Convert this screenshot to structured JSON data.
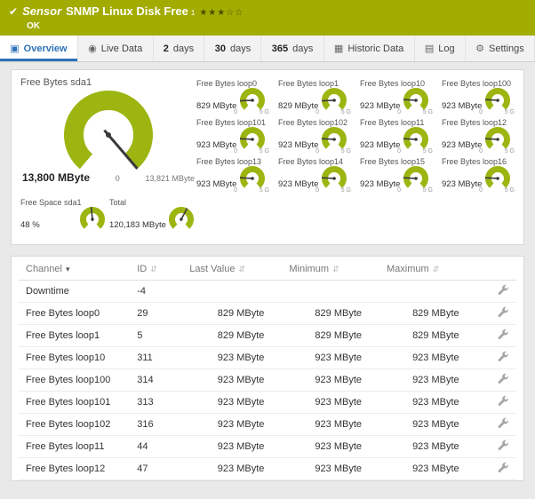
{
  "colors": {
    "header_green": "#a2ab00",
    "gauge_green": "#9db511",
    "active_tab_blue": "#2e71b8"
  },
  "icons": {
    "header_status": "check-icon",
    "tab_overview": "grid-icon",
    "tab_live": "broadcast-icon",
    "tab_historic": "chart-icon",
    "tab_log": "list-icon",
    "tab_settings": "gear-icon",
    "row_action": "wrench-icon",
    "sort_channel": "caret-down-icon",
    "sort_other": "updown-arrows-icon"
  },
  "header": {
    "kind": "Sensor",
    "title": "SNMP Linux Disk Free",
    "superscript": "1",
    "priority_stars": "★★★☆☆",
    "status": "OK"
  },
  "tabs": [
    {
      "label": "Overview"
    },
    {
      "label": "Live Data"
    },
    {
      "num": "2",
      "label": "days"
    },
    {
      "num": "30",
      "label": "days"
    },
    {
      "num": "365",
      "label": "days"
    },
    {
      "label": "Historic Data"
    },
    {
      "label": "Log"
    },
    {
      "label": "Settings"
    }
  ],
  "gauges": {
    "main": {
      "label": "Free Bytes sda1",
      "value": "13,800 MByte",
      "tick_min": "0",
      "tick_max": "13,821 MByte",
      "fraction": 0.998
    },
    "small": [
      {
        "label": "Free Bytes loop0",
        "value": "829 MByte",
        "tick_min": "0",
        "tick_max": "5 G",
        "fraction": 0.17
      },
      {
        "label": "Free Bytes loop1",
        "value": "829 MByte",
        "tick_min": "0",
        "tick_max": "5 G",
        "fraction": 0.17
      },
      {
        "label": "Free Bytes loop10",
        "value": "923 MByte",
        "tick_min": "0",
        "tick_max": "5 G",
        "fraction": 0.19
      },
      {
        "label": "Free Bytes loop100",
        "value": "923 MByte",
        "tick_min": "0",
        "tick_max": "5 G",
        "fraction": 0.19
      },
      {
        "label": "Free Bytes loop101",
        "value": "923 MByte",
        "tick_min": "0",
        "tick_max": "5 G",
        "fraction": 0.19
      },
      {
        "label": "Free Bytes loop102",
        "value": "923 MByte",
        "tick_min": "0",
        "tick_max": "5 G",
        "fraction": 0.19
      },
      {
        "label": "Free Bytes loop11",
        "value": "923 MByte",
        "tick_min": "0",
        "tick_max": "5 G",
        "fraction": 0.19
      },
      {
        "label": "Free Bytes loop12",
        "value": "923 MByte",
        "tick_min": "0",
        "tick_max": "5 G",
        "fraction": 0.19
      },
      {
        "label": "Free Bytes loop13",
        "value": "923 MByte",
        "tick_min": "0",
        "tick_max": "5 G",
        "fraction": 0.19
      },
      {
        "label": "Free Bytes loop14",
        "value": "923 MByte",
        "tick_min": "0",
        "tick_max": "5 G",
        "fraction": 0.19
      },
      {
        "label": "Free Bytes loop15",
        "value": "923 MByte",
        "tick_min": "0",
        "tick_max": "5 G",
        "fraction": 0.19
      },
      {
        "label": "Free Bytes loop16",
        "value": "923 MByte",
        "tick_min": "0",
        "tick_max": "5 G",
        "fraction": 0.19
      }
    ],
    "bottom": [
      {
        "label": "Free Space sda1",
        "value": "48 %",
        "tick_min": "",
        "tick_max": "",
        "fraction": 0.48
      },
      {
        "label": "Total",
        "value": "120,183 MByte",
        "tick_min": "",
        "tick_max": "",
        "fraction": 0.6
      }
    ]
  },
  "table": {
    "columns": [
      "Channel",
      "ID",
      "Last Value",
      "Minimum",
      "Maximum"
    ],
    "rows": [
      {
        "channel": "Downtime",
        "id": "-4",
        "last": "",
        "min": "",
        "max": ""
      },
      {
        "channel": "Free Bytes loop0",
        "id": "29",
        "last": "829 MByte",
        "min": "829 MByte",
        "max": "829 MByte"
      },
      {
        "channel": "Free Bytes loop1",
        "id": "5",
        "last": "829 MByte",
        "min": "829 MByte",
        "max": "829 MByte"
      },
      {
        "channel": "Free Bytes loop10",
        "id": "311",
        "last": "923 MByte",
        "min": "923 MByte",
        "max": "923 MByte"
      },
      {
        "channel": "Free Bytes loop100",
        "id": "314",
        "last": "923 MByte",
        "min": "923 MByte",
        "max": "923 MByte"
      },
      {
        "channel": "Free Bytes loop101",
        "id": "313",
        "last": "923 MByte",
        "min": "923 MByte",
        "max": "923 MByte"
      },
      {
        "channel": "Free Bytes loop102",
        "id": "316",
        "last": "923 MByte",
        "min": "923 MByte",
        "max": "923 MByte"
      },
      {
        "channel": "Free Bytes loop11",
        "id": "44",
        "last": "923 MByte",
        "min": "923 MByte",
        "max": "923 MByte"
      },
      {
        "channel": "Free Bytes loop12",
        "id": "47",
        "last": "923 MByte",
        "min": "923 MByte",
        "max": "923 MByte"
      }
    ]
  }
}
